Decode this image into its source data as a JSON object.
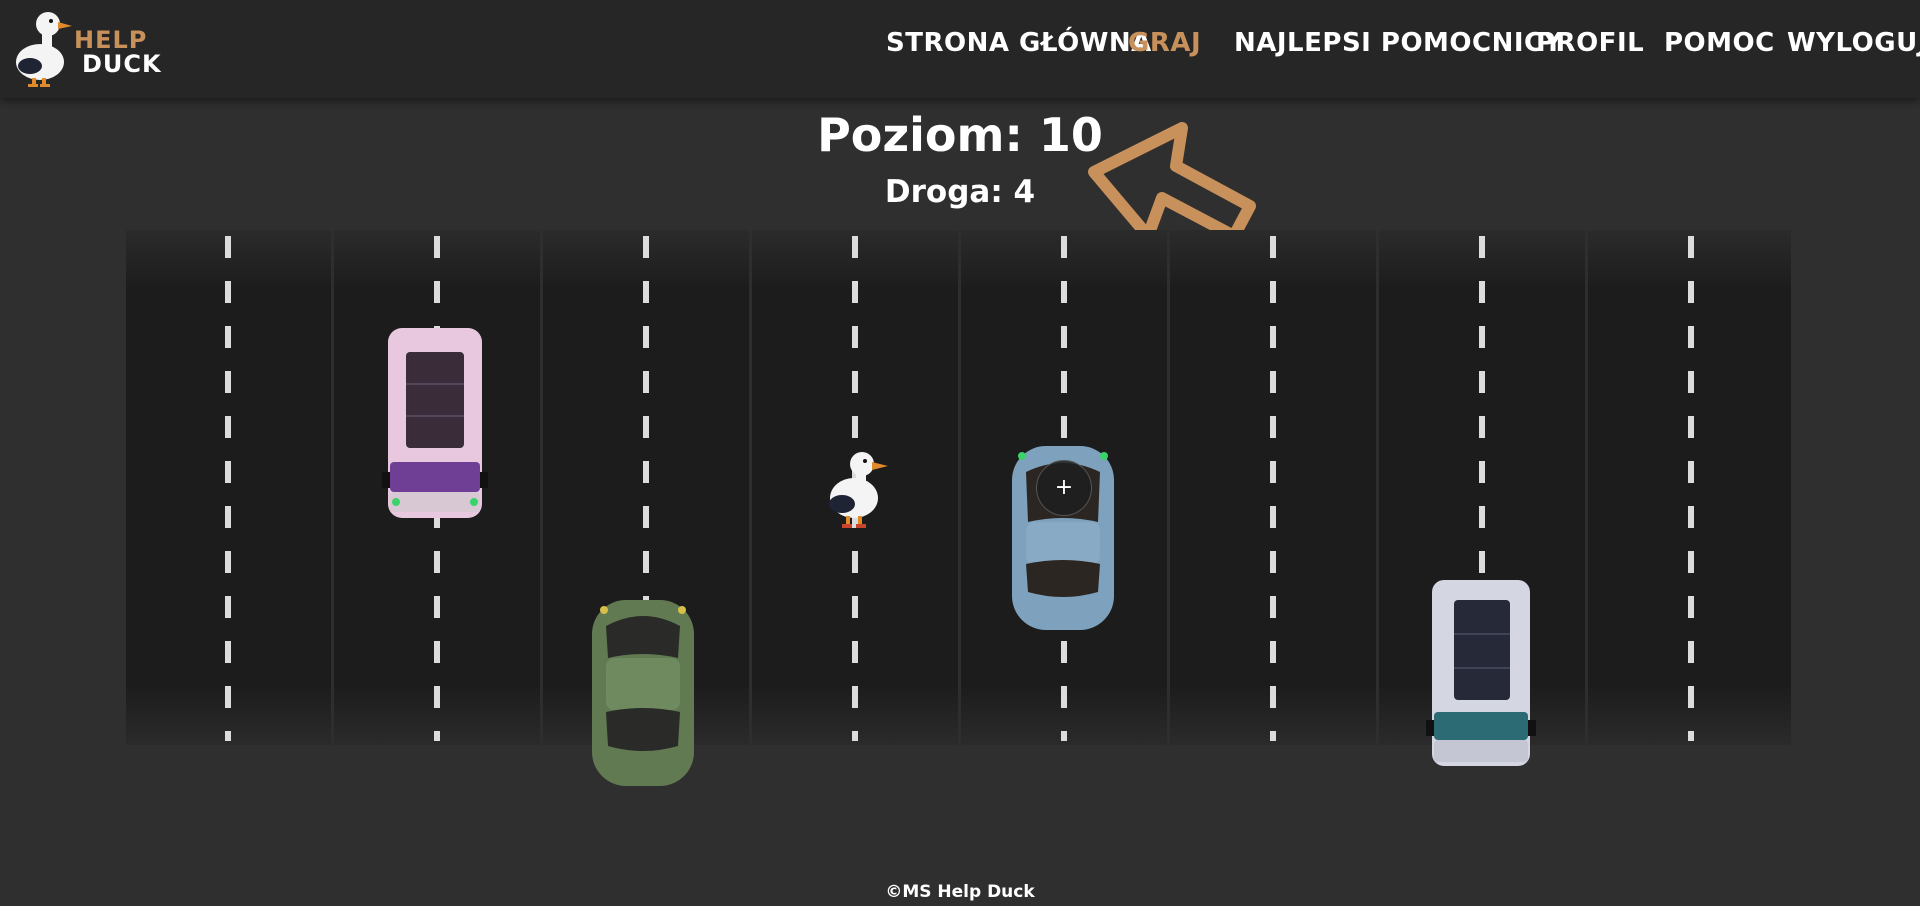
{
  "app": {
    "logo_line1": "HELP",
    "logo_line2": "DUCK",
    "accent_color": "#c8905a"
  },
  "nav": {
    "items": [
      {
        "label": "Strona Główna"
      },
      {
        "label": "Graj",
        "active": true
      },
      {
        "label": "Najlepsi pomocnicy"
      },
      {
        "label": "Profil"
      },
      {
        "label": "Pomoc"
      },
      {
        "label": "Wyloguj"
      }
    ]
  },
  "game": {
    "level": "Poziom: 10",
    "road": "Droga: 4",
    "hint_icon": "arrow-up-left-icon",
    "action_icon": "plus-icon",
    "action_symbol": "+"
  },
  "footer": {
    "text": "©MS Help Duck"
  }
}
